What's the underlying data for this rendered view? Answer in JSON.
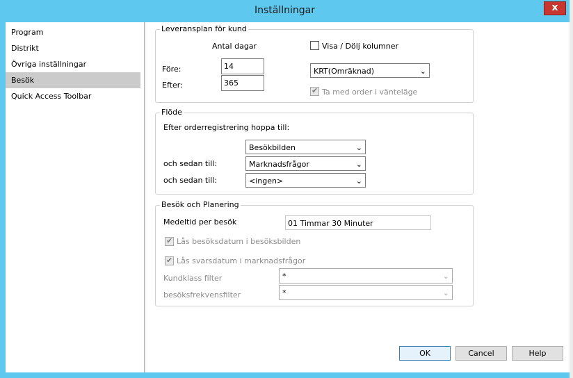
{
  "window": {
    "title": "Inställningar",
    "close_glyph": "x"
  },
  "sidebar": {
    "items": [
      {
        "label": "Program"
      },
      {
        "label": "Distrikt"
      },
      {
        "label": "Övriga inställningar"
      },
      {
        "label": "Besök"
      },
      {
        "label": "Quick Access Toolbar"
      }
    ],
    "selected": "Besök"
  },
  "delivery_group": {
    "legend": "Leveransplan för kund",
    "days_header": "Antal dagar",
    "before_label": "Före:",
    "before_value": "14",
    "after_label": "Efter:",
    "after_value": "365",
    "show_columns_label": "Visa / Dölj kolumner",
    "show_columns_checked": false,
    "price_select_value": "KRT(Omräknad)",
    "include_pending_label": "Ta med order i vänteläge",
    "include_pending_checked": true
  },
  "flow_group": {
    "legend": "Flöde",
    "after_order_label": "Efter orderregistrering hoppa till:",
    "step1_value": "Besökbilden",
    "then_label_1": "och sedan till:",
    "step2_value": "Marknadsfrågor",
    "then_label_2": "och sedan till:",
    "step3_value": "<ingen>"
  },
  "visit_group": {
    "legend": "Besök och Planering",
    "avg_time_label": "Medeltid per besök",
    "avg_time_value": "01 Timmar 30 Minuter",
    "lock_visit_date_label": "Lås besöksdatum i besöksbilden",
    "lock_visit_date_checked": true,
    "lock_answer_date_label": "Lås svarsdatum i marknadsfrågor",
    "lock_answer_date_checked": true,
    "customer_class_filter_label": "Kundklass filter",
    "customer_class_filter_value": "*",
    "visit_freq_filter_label": "besöksfrekvensfilter",
    "visit_freq_filter_value": "*"
  },
  "buttons": {
    "ok": "OK",
    "cancel": "Cancel",
    "help": "Help"
  },
  "glyphs": {
    "chevron": "⌄",
    "check": "✔"
  },
  "colors": {
    "titlebar": "#5ec8ee",
    "close": "#c7372f",
    "selected_nav": "#cbcbcb"
  }
}
